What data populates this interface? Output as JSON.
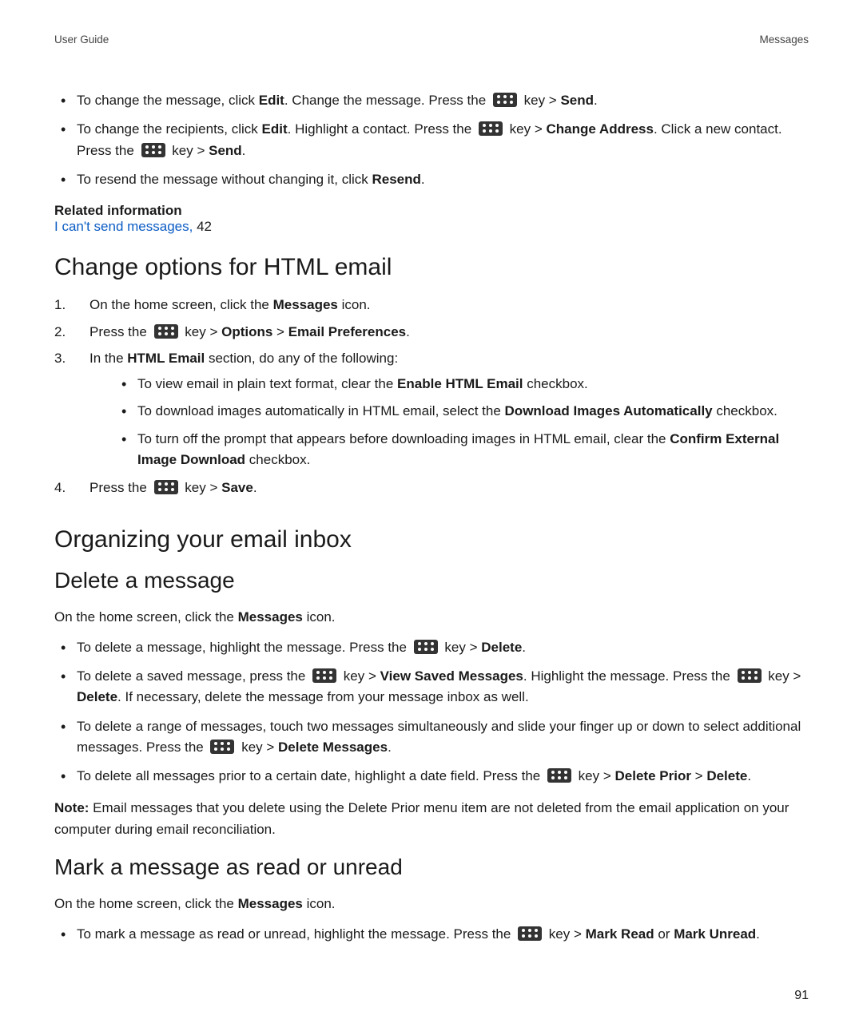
{
  "header": {
    "left": "User Guide",
    "right": "Messages"
  },
  "page_number": "91",
  "intro_bullets": {
    "b1": {
      "t1": "To change the message, click ",
      "edit": "Edit",
      "t2": ". Change the message. Press the ",
      "t3": " key > ",
      "send": "Send",
      "t4": "."
    },
    "b2": {
      "t1": "To change the recipients, click ",
      "edit": "Edit",
      "t2": ". Highlight a contact. Press the ",
      "t3": " key > ",
      "change_addr": "Change Address",
      "t4": ". Click a new contact. Press the ",
      "t5": " key > ",
      "send": "Send",
      "t6": "."
    },
    "b3": {
      "t1": "To resend the message without changing it, click ",
      "resend": "Resend",
      "t2": "."
    }
  },
  "related": {
    "heading": "Related information",
    "link_text": "I can't send messages,",
    "page_ref": " 42"
  },
  "section1": {
    "title": "Change options for HTML email",
    "step1": {
      "t1": "On the home screen, click the ",
      "msgs": "Messages",
      "t2": " icon."
    },
    "step2": {
      "t1": "Press the ",
      "t2": " key > ",
      "opt": "Options",
      "sep": " > ",
      "pref": "Email Preferences",
      "t3": "."
    },
    "step3": {
      "t1": "In the ",
      "html": "HTML Email",
      "t2": " section, do any of the following:"
    },
    "sub": {
      "a": {
        "t1": "To view email in plain text format, clear the ",
        "cb": "Enable HTML Email",
        "t2": " checkbox."
      },
      "b": {
        "t1": "To download images automatically in HTML email, select the ",
        "cb": "Download Images Automatically",
        "t2": " checkbox."
      },
      "c": {
        "t1": "To turn off the prompt that appears before downloading images in HTML email, clear the ",
        "cb": "Confirm External Image Download",
        "t2": " checkbox."
      }
    },
    "step4": {
      "t1": "Press the ",
      "t2": " key > ",
      "save": "Save",
      "t3": "."
    }
  },
  "section2": {
    "title": "Organizing your email inbox"
  },
  "section3": {
    "title": "Delete a message",
    "intro": {
      "t1": "On the home screen, click the ",
      "msgs": "Messages",
      "t2": " icon."
    },
    "b1": {
      "t1": "To delete a message, highlight the message. Press the ",
      "t2": " key > ",
      "del": "Delete",
      "t3": "."
    },
    "b2": {
      "t1": "To delete a saved message, press the ",
      "t2": " key > ",
      "vsm": "View Saved Messages",
      "t3": ". Highlight the message. Press the ",
      "t4": " key > ",
      "del": "Delete",
      "t5": ". If necessary, delete the message from your message inbox as well."
    },
    "b3": {
      "t1": "To delete a range of messages, touch two messages simultaneously and slide your finger up or down to select additional messages. Press the ",
      "t2": " key > ",
      "dm": "Delete Messages",
      "t3": "."
    },
    "b4": {
      "t1": "To delete all messages prior to a certain date, highlight a date field. Press the ",
      "t2": " key > ",
      "dp": "Delete Prior",
      "sep": " > ",
      "del": "Delete",
      "t3": "."
    },
    "note": {
      "label": "Note: ",
      "text": "Email messages that you delete using the Delete Prior menu item are not deleted from the email application on your computer during email reconciliation."
    }
  },
  "section4": {
    "title": "Mark a message as read or unread",
    "intro": {
      "t1": "On the home screen, click the ",
      "msgs": "Messages",
      "t2": " icon."
    },
    "b1": {
      "t1": "To mark a message as read or unread, highlight the message. Press the ",
      "t2": " key > ",
      "mr": "Mark Read",
      "or": " or ",
      "mu": "Mark Unread",
      "t3": "."
    }
  }
}
